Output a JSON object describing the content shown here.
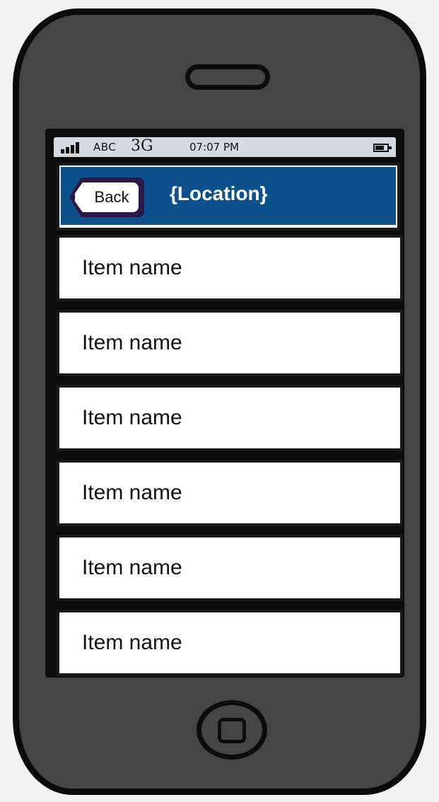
{
  "statusbar": {
    "carrier": "ABC",
    "network": "3G",
    "time": "07:07 PM"
  },
  "navbar": {
    "back_label": "Back",
    "title": "{Location}",
    "color": "#0c508e"
  },
  "list": {
    "items": [
      {
        "label": "Item name"
      },
      {
        "label": "Item name"
      },
      {
        "label": "Item name"
      },
      {
        "label": "Item name"
      },
      {
        "label": "Item name"
      },
      {
        "label": "Item name"
      }
    ]
  },
  "icons": {
    "signal": "signal-bars-icon",
    "battery": "battery-icon",
    "home": "home-button-icon",
    "speaker": "speaker-slot"
  }
}
